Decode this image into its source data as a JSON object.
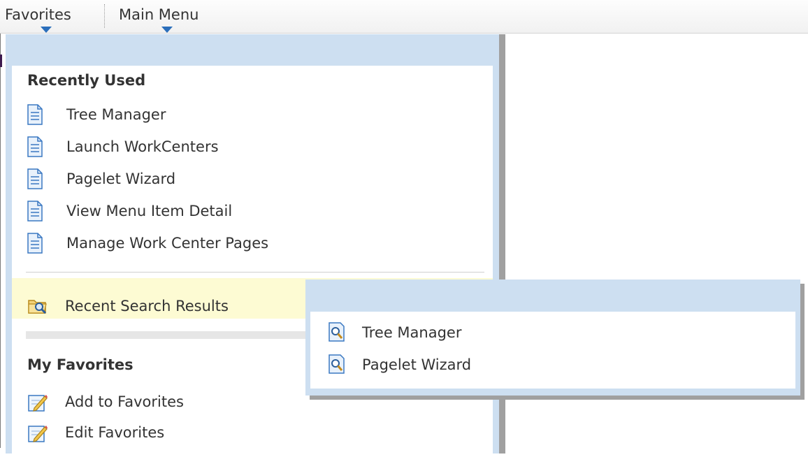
{
  "menubar": {
    "favorites_label": "Favorites",
    "main_menu_label": "Main Menu"
  },
  "favorites_menu": {
    "recently_used": {
      "title": "Recently Used",
      "items": [
        {
          "label": "Tree Manager",
          "icon": "page-icon"
        },
        {
          "label": "Launch WorkCenters",
          "icon": "page-icon"
        },
        {
          "label": "Pagelet Wizard",
          "icon": "page-icon"
        },
        {
          "label": "View Menu Item Detail",
          "icon": "page-icon"
        },
        {
          "label": "Manage Work Center Pages",
          "icon": "page-icon"
        }
      ]
    },
    "recent_search_results": {
      "label": "Recent Search Results",
      "icon": "folder-search-icon"
    },
    "my_favorites": {
      "title": "My Favorites",
      "items": [
        {
          "label": "Add to Favorites",
          "icon": "edit-pencil-icon"
        },
        {
          "label": "Edit Favorites",
          "icon": "edit-pencil-icon"
        }
      ]
    }
  },
  "search_results_submenu": {
    "items": [
      {
        "label": "Tree Manager",
        "icon": "search-page-icon"
      },
      {
        "label": "Pagelet Wizard",
        "icon": "search-page-icon"
      }
    ]
  },
  "colors": {
    "menu_panel_bg": "#cddff1",
    "caret_blue": "#2a6ebb",
    "highlight_yellow": "#fdfbd3",
    "panel_shadow": "#a0a0a0"
  }
}
